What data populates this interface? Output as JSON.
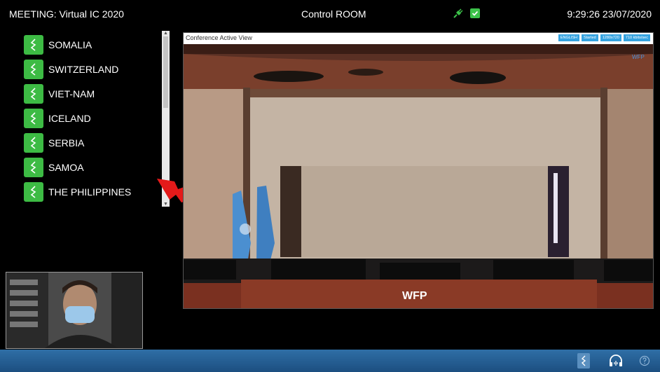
{
  "header": {
    "meeting": "MEETING: Virtual IC 2020",
    "room": "Control ROOM",
    "clock": "9:29:26 23/07/2020",
    "status_icons": [
      "plug-icon",
      "check-icon"
    ]
  },
  "speakers": [
    {
      "label": "SOMALIA"
    },
    {
      "label": "SWITZERLAND"
    },
    {
      "label": "VIET-NAM"
    },
    {
      "label": "ICELAND"
    },
    {
      "label": "SERBIA"
    },
    {
      "label": "SAMOA"
    },
    {
      "label": "THE PHILIPPINES"
    }
  ],
  "conference": {
    "title": "Conference Active View",
    "badges": [
      "ENGLISH",
      "Started",
      "1280x720",
      "710 kbits/sec"
    ],
    "podium_text": "WFP",
    "logo_text": "WFP"
  },
  "bottom_bar": {
    "icons": [
      "speaker-icon",
      "headset-icon",
      "help-icon"
    ]
  },
  "colors": {
    "accent_green": "#3dbb44",
    "bar_blue": "#2f6fa6",
    "annotation_red": "#e41a1a"
  }
}
